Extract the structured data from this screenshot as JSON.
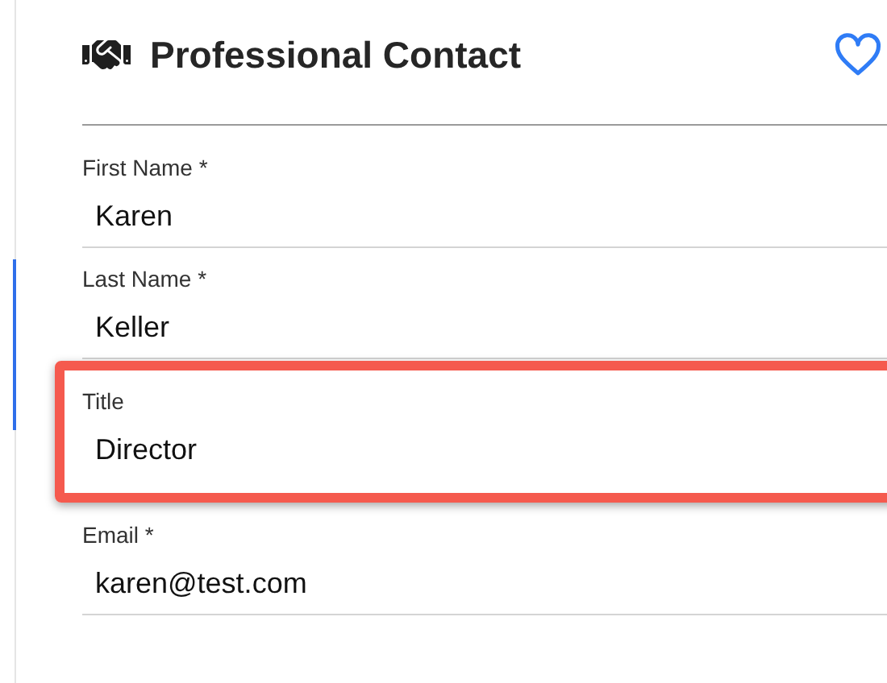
{
  "header": {
    "title": "Professional Contact",
    "favorite": false
  },
  "fields": [
    {
      "label": "First Name *",
      "value": "Karen",
      "highlighted": false
    },
    {
      "label": "Last Name *",
      "value": "Keller",
      "highlighted": false
    },
    {
      "label": "Title",
      "value": "Director",
      "highlighted": true
    },
    {
      "label": "Email *",
      "value": "karen@test.com",
      "highlighted": false
    }
  ]
}
